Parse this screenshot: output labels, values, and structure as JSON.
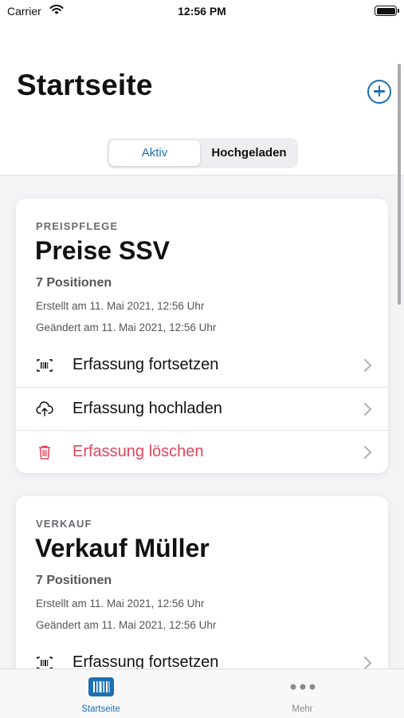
{
  "status_bar": {
    "carrier": "Carrier",
    "time": "12:56 PM"
  },
  "header": {
    "title": "Startseite",
    "segments": [
      {
        "label": "Aktiv",
        "selected": true
      },
      {
        "label": "Hochgeladen",
        "selected": false
      }
    ]
  },
  "cards": [
    {
      "category": "PREISPFLEGE",
      "title": "Preise SSV",
      "count": "7 Positionen",
      "created": "Erstellt am 11. Mai 2021, 12:56 Uhr",
      "changed": "Geändert am 11. Mai 2021, 12:56 Uhr",
      "actions": [
        {
          "label": "Erfassung fortsetzen",
          "icon": "barcode-icon"
        },
        {
          "label": "Erfassung hochladen",
          "icon": "cloud-upload-icon"
        },
        {
          "label": "Erfassung löschen",
          "icon": "trash-icon",
          "destructive": true
        }
      ]
    },
    {
      "category": "VERKAUF",
      "title": "Verkauf Müller",
      "count": "7 Positionen",
      "created": "Erstellt am 11. Mai 2021, 12:56 Uhr",
      "changed": "Geändert am 11. Mai 2021, 12:56 Uhr",
      "actions": [
        {
          "label": "Erfassung fortsetzen",
          "icon": "barcode-icon"
        }
      ]
    }
  ],
  "tabbar": {
    "items": [
      {
        "label": "Startseite",
        "icon": "barcode-tab-icon",
        "active": true
      },
      {
        "label": "Mehr",
        "icon": "more-dots-icon",
        "active": false
      }
    ]
  },
  "colors": {
    "accent": "#1e6fb0",
    "destructive": "#e2455a",
    "secondary_text": "#555555",
    "background": "#f4f4f6"
  }
}
